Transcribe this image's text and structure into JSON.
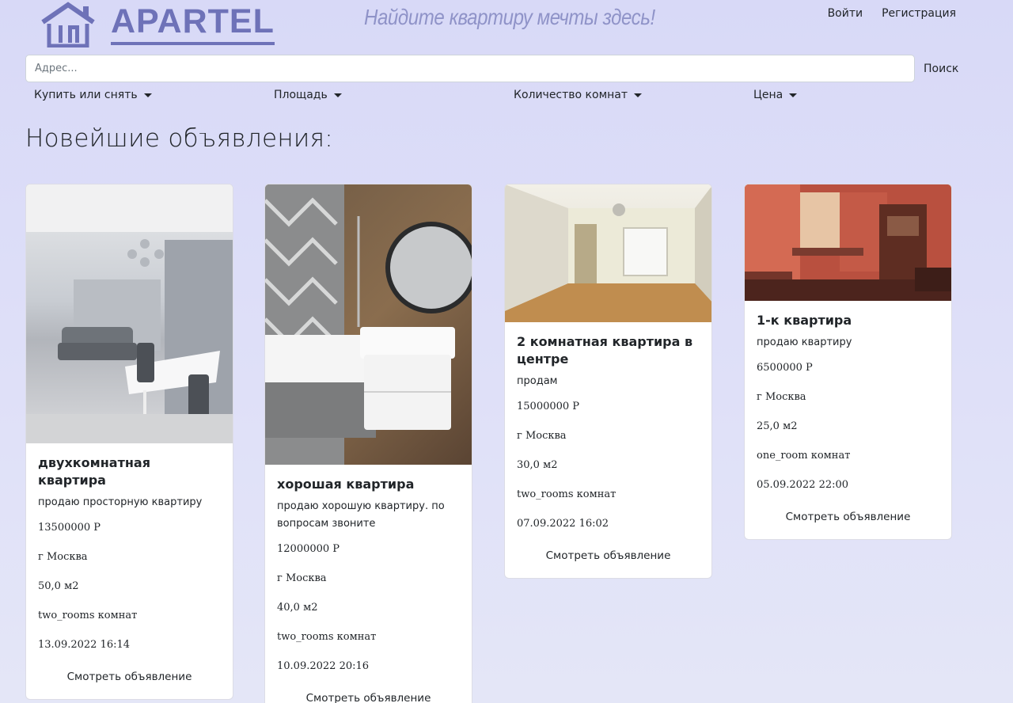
{
  "header": {
    "brand": "APARTEL",
    "tagline": "Найдите квартиру мечты здесь!",
    "login": "Войти",
    "register": "Регистрация"
  },
  "search": {
    "placeholder": "Адрес...",
    "button": "Поиск"
  },
  "filters": [
    {
      "label": "Купить или снять"
    },
    {
      "label": "Площадь"
    },
    {
      "label": "Количество комнат"
    },
    {
      "label": "Цена"
    }
  ],
  "section_title": "Новейшие объявления:",
  "listings": [
    {
      "title": "двухкомнатная квартира",
      "description": "продаю просторную квартиру",
      "price": "13500000 Р",
      "city": "г Москва",
      "area": "50,0 м2",
      "rooms": "two_rooms комнат",
      "date": "13.09.2022 16:14",
      "link": "Смотреть объявление",
      "image": "living-room-photo"
    },
    {
      "title": "хорошая квартира",
      "description": "продаю хорошую квартиру. по вопросам звоните",
      "price": "12000000 Р",
      "city": "г Москва",
      "area": "40,0 м2",
      "rooms": "two_rooms комнат",
      "date": "10.09.2022 20:16",
      "link": "Смотреть объявление",
      "image": "bathroom-photo"
    },
    {
      "title": "2 комнатная квартира в центре",
      "description": "продам",
      "price": "15000000 Р",
      "city": "г Москва",
      "area": "30,0 м2",
      "rooms": "two_rooms комнат",
      "date": "07.09.2022 16:02",
      "link": "Смотреть объявление",
      "image": "empty-room-photo"
    },
    {
      "title": "1-к квартира",
      "description": "продаю квартиру",
      "price": "6500000 Р",
      "city": "г Москва",
      "area": "25,0 м2",
      "rooms": "one_room комнат",
      "date": "05.09.2022 22:00",
      "link": "Смотреть объявление",
      "image": "retro-room-photo"
    }
  ]
}
